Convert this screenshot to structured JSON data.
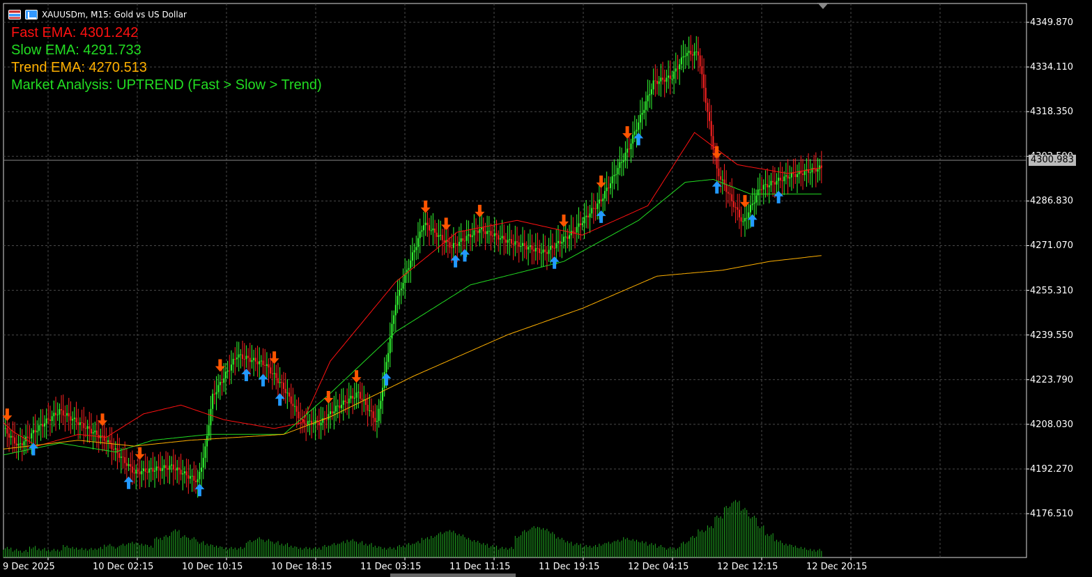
{
  "title_bar": {
    "symbol_label": "XAUUSDm, M15:  Gold vs US Dollar"
  },
  "indicators": {
    "fast": {
      "label": "Fast EMA: 4301.242",
      "color": "#ff1111"
    },
    "slow": {
      "label": "Slow EMA: 4291.733",
      "color": "#22dd22"
    },
    "trend": {
      "label": "Trend EMA: 4270.513",
      "color": "#ffb000"
    },
    "market": {
      "label": "Market Analysis: UPTREND (Fast > Slow > Trend)",
      "color": "#22dd22"
    }
  },
  "price_axis": {
    "labels": [
      "4349.870",
      "4334.110",
      "4318.350",
      "4302.590",
      "4286.830",
      "4271.070",
      "4255.310",
      "4239.550",
      "4223.790",
      "4208.030",
      "4192.270",
      "4176.510"
    ],
    "current_price": "4300.983"
  },
  "time_axis": {
    "labels": [
      "9 Dec 2025",
      "10 Dec 02:15",
      "10 Dec 10:15",
      "10 Dec 18:15",
      "11 Dec 03:15",
      "11 Dec 11:15",
      "11 Dec 19:15",
      "12 Dec 04:15",
      "12 Dec 12:15",
      "12 Dec 20:15"
    ]
  },
  "colors": {
    "bull": "#33ff33",
    "bear": "#ff2222",
    "buy_arrow": "#2299ff",
    "sell_arrow": "#ff5500",
    "grid": "#4a4a4a",
    "volume": "#22aa22"
  },
  "chart_data": {
    "type": "line",
    "title": "XAUUSDm, M15:  Gold vs US Dollar",
    "ylim": [
      4168.0,
      4357.0
    ],
    "x": [
      "9 Dec 2025",
      "10 Dec 02:15",
      "10 Dec 10:15",
      "10 Dec 18:15",
      "11 Dec 03:15",
      "11 Dec 11:15",
      "11 Dec 19:15",
      "12 Dec 04:15",
      "12 Dec 12:15",
      "12 Dec 20:15"
    ],
    "series": [
      {
        "name": "Fast EMA",
        "color": "#ff1111",
        "points": [
          [
            0,
            4214
          ],
          [
            5,
            4211
          ],
          [
            18,
            4206
          ],
          [
            40,
            4210
          ],
          [
            55,
            4209
          ],
          [
            75,
            4217
          ],
          [
            95,
            4220
          ],
          [
            118,
            4215
          ],
          [
            145,
            4212
          ],
          [
            160,
            4214
          ],
          [
            175,
            4235
          ],
          [
            210,
            4262
          ],
          [
            243,
            4279
          ],
          [
            275,
            4283
          ],
          [
            310,
            4278
          ],
          [
            345,
            4288
          ],
          [
            370,
            4313
          ],
          [
            393,
            4302
          ],
          [
            420,
            4299
          ],
          [
            438,
            4301
          ]
        ]
      },
      {
        "name": "Slow EMA",
        "color": "#22dd22",
        "points": [
          [
            0,
            4203
          ],
          [
            30,
            4207
          ],
          [
            60,
            4204
          ],
          [
            80,
            4208
          ],
          [
            110,
            4210
          ],
          [
            150,
            4210
          ],
          [
            175,
            4224
          ],
          [
            210,
            4245
          ],
          [
            250,
            4261
          ],
          [
            300,
            4269
          ],
          [
            340,
            4283
          ],
          [
            365,
            4296
          ],
          [
            380,
            4297
          ],
          [
            400,
            4292
          ],
          [
            438,
            4292
          ]
        ]
      },
      {
        "name": "Trend EMA",
        "color": "#ffb000",
        "points": [
          [
            0,
            4205
          ],
          [
            40,
            4208
          ],
          [
            70,
            4206
          ],
          [
            100,
            4208
          ],
          [
            150,
            4210
          ],
          [
            175,
            4216
          ],
          [
            220,
            4230
          ],
          [
            270,
            4244
          ],
          [
            310,
            4253
          ],
          [
            350,
            4264
          ],
          [
            385,
            4266
          ],
          [
            410,
            4269
          ],
          [
            438,
            4271
          ]
        ]
      },
      {
        "name": "Price",
        "color": "#33ff33",
        "points": [
          [
            0,
            4212
          ],
          [
            8,
            4206
          ],
          [
            20,
            4213
          ],
          [
            30,
            4218
          ],
          [
            45,
            4212
          ],
          [
            55,
            4208
          ],
          [
            70,
            4197
          ],
          [
            90,
            4199
          ],
          [
            104,
            4194
          ],
          [
            108,
            4205
          ],
          [
            112,
            4223
          ],
          [
            125,
            4237
          ],
          [
            140,
            4234
          ],
          [
            150,
            4226
          ],
          [
            160,
            4214
          ],
          [
            170,
            4214
          ],
          [
            178,
            4219
          ],
          [
            190,
            4224
          ],
          [
            200,
            4214
          ],
          [
            210,
            4255
          ],
          [
            225,
            4282
          ],
          [
            240,
            4274
          ],
          [
            255,
            4280
          ],
          [
            270,
            4276
          ],
          [
            290,
            4272
          ],
          [
            305,
            4279
          ],
          [
            320,
            4290
          ],
          [
            335,
            4308
          ],
          [
            348,
            4330
          ],
          [
            358,
            4332
          ],
          [
            365,
            4340
          ],
          [
            372,
            4340
          ],
          [
            382,
            4300
          ],
          [
            396,
            4282
          ],
          [
            405,
            4294
          ],
          [
            420,
            4298
          ],
          [
            438,
            4301
          ]
        ]
      }
    ],
    "buy_signals_x": [
      16,
      67,
      105,
      130,
      139,
      148,
      205,
      242,
      247,
      295,
      320,
      340,
      382,
      401,
      415
    ],
    "sell_signals_x": [
      2,
      53,
      73,
      116,
      145,
      174,
      189,
      226,
      237,
      255,
      300,
      320,
      334,
      382,
      397
    ],
    "volume": [
      8,
      6,
      5,
      9,
      7,
      6,
      6,
      10,
      8,
      7,
      7,
      8,
      11,
      9,
      12,
      14,
      12,
      10,
      18,
      20,
      26,
      20,
      18,
      14,
      12,
      10,
      8,
      8,
      8,
      15,
      18,
      16,
      14,
      12,
      10,
      8,
      8,
      8,
      10,
      12,
      14,
      16,
      14,
      12,
      10,
      8,
      8,
      10,
      12,
      14,
      18,
      20,
      24,
      26,
      22,
      18,
      15,
      12,
      10,
      8,
      8,
      20,
      26,
      30,
      28,
      24,
      18,
      14,
      12,
      10,
      10,
      12,
      14,
      16,
      18,
      16,
      14,
      12,
      10,
      8,
      8,
      14,
      20,
      26,
      30,
      40,
      50,
      56,
      48,
      40,
      30,
      22,
      16,
      12,
      10,
      8,
      6,
      6
    ]
  }
}
